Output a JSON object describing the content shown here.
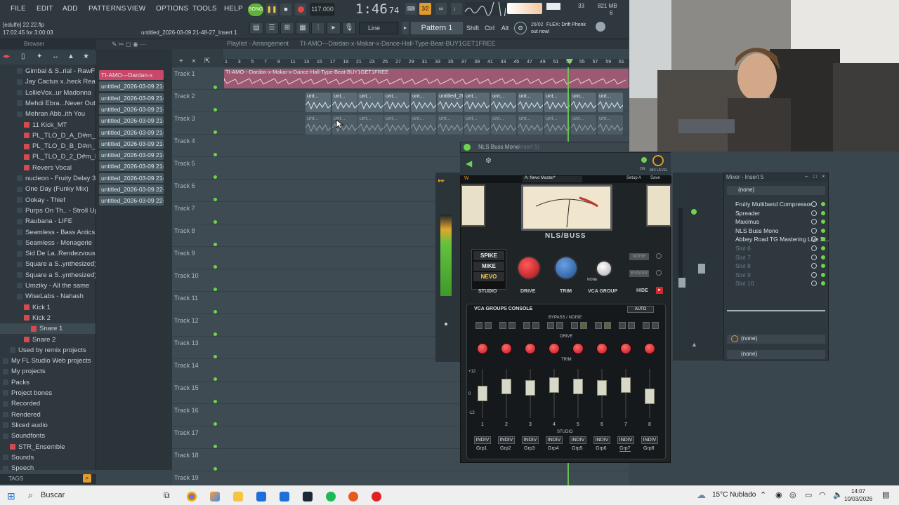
{
  "menu": {
    "items": [
      "FILE",
      "EDIT",
      "ADD",
      "PATTERNS",
      "VIEW",
      "OPTIONS",
      "TOOLS",
      "HELP"
    ],
    "song_label": "SONG",
    "tempo": "117.000",
    "time": "1:46",
    "time_sub": "74",
    "time_unit": "M:S:CS",
    "cpu": "33",
    "ram": "821 MB",
    "ram_sub": "6"
  },
  "hint_bar": {
    "file": "[edulfe] 22.22.flp",
    "elapsed": "17:02:45 for 3:00:03",
    "project_name": "untitled_2026-03-09 21-48-27_Insert 1"
  },
  "toolbar2": {
    "snap": "Line",
    "pattern": "Pattern 1",
    "keys": [
      "Shift",
      "Ctrl",
      "Alt"
    ],
    "news_date": "26/02",
    "news_text": "FLEX: Drift Phonk",
    "news_sub": "out now!"
  },
  "browser": {
    "title": "Browser",
    "items": [
      {
        "label": "Gimbal & S..rial - RawFL",
        "kind": "folder",
        "indent": 2
      },
      {
        "label": "Jay Cactus x..heck Ready",
        "kind": "folder",
        "indent": 2
      },
      {
        "label": "LollieVox..ur Madonna",
        "kind": "folder",
        "indent": 2
      },
      {
        "label": "Mehdi Ebra...Never Out",
        "kind": "folder",
        "indent": 2
      },
      {
        "label": "Mehran Abb..ith You",
        "kind": "folder-open",
        "indent": 2
      },
      {
        "label": "11 Kick_MT",
        "kind": "file",
        "indent": 3
      },
      {
        "label": "PL_TLO_D_A_D#m_Dry",
        "kind": "file",
        "indent": 3
      },
      {
        "label": "PL_TLO_D_B_D#m_Dry",
        "kind": "file",
        "indent": 3
      },
      {
        "label": "PL_TLO_D_2_D#m_Dry",
        "kind": "file",
        "indent": 3
      },
      {
        "label": "Revers Vocal",
        "kind": "file",
        "indent": 3
      },
      {
        "label": "nucleon - Fruity Delay 3",
        "kind": "folder",
        "indent": 2
      },
      {
        "label": "One Day (Funky Mix)",
        "kind": "folder",
        "indent": 2
      },
      {
        "label": "Ookay - Thief",
        "kind": "folder",
        "indent": 2
      },
      {
        "label": "Purps On Th.. - Stroll Up",
        "kind": "folder",
        "indent": 2
      },
      {
        "label": "Raubana - LIFE",
        "kind": "folder",
        "indent": 2
      },
      {
        "label": "Seamless - Bass Antics",
        "kind": "folder",
        "indent": 2
      },
      {
        "label": "Seamless - Menagerie",
        "kind": "folder",
        "indent": 2
      },
      {
        "label": "Sid De La..Rendezvous",
        "kind": "folder",
        "indent": 2
      },
      {
        "label": "Square a S..ynthesized)",
        "kind": "folder",
        "indent": 2
      },
      {
        "label": "Square a S..ynthesized)",
        "kind": "folder",
        "indent": 2
      },
      {
        "label": "Umziky - All the same",
        "kind": "folder",
        "indent": 2
      },
      {
        "label": "WiseLabs - Nahash",
        "kind": "folder-open",
        "indent": 2
      },
      {
        "label": "Kick 1",
        "kind": "file",
        "indent": 3
      },
      {
        "label": "Kick 2",
        "kind": "file",
        "indent": 3
      },
      {
        "label": "Snare 1",
        "kind": "file-sel",
        "indent": 4
      },
      {
        "label": "Snare 2",
        "kind": "file",
        "indent": 3
      },
      {
        "label": "Used by remix projects",
        "kind": "folder",
        "indent": 1
      },
      {
        "label": "My FL Studio Web projects",
        "kind": "folder",
        "indent": 0
      },
      {
        "label": "My projects",
        "kind": "folder",
        "indent": 0
      },
      {
        "label": "Packs",
        "kind": "folder",
        "indent": 0
      },
      {
        "label": "Project bones",
        "kind": "folder",
        "indent": 0
      },
      {
        "label": "Recorded",
        "kind": "plus",
        "indent": 0
      },
      {
        "label": "Rendered",
        "kind": "plus",
        "indent": 0
      },
      {
        "label": "Sliced audio",
        "kind": "plus",
        "indent": 0
      },
      {
        "label": "Soundfonts",
        "kind": "folder-open",
        "indent": 0
      },
      {
        "label": "STR_Ensemble",
        "kind": "file",
        "indent": 1
      },
      {
        "label": "Sounds",
        "kind": "folder",
        "indent": 0
      },
      {
        "label": "Speech",
        "kind": "folder",
        "indent": 0
      },
      {
        "label": "Templates",
        "kind": "folder",
        "indent": 0
      }
    ],
    "tags_label": "TAGS"
  },
  "playlist": {
    "title": "Playlist - Arrangement",
    "song_name": "TI-AMO---Dardan-x-Makar-x-Dance-Hall-Type-Beat-BUY1GET1FREE",
    "clips": [
      "TI-AMO---Dardan-x",
      "untitled_2026-03-09 21-",
      "untitled_2026-03-09 21-",
      "untitled_2026-03-09 21-",
      "untitled_2026-03-09 21-",
      "untitled_2026-03-09 21-",
      "untitled_2026-03-09 21-",
      "untitled_2026-03-09 21-",
      "untitled_2026-03-09 21-",
      "untitled_2026-03-09 21-",
      "untitled_2026-03-09 22-",
      "untitled_2026-03-09 22-"
    ],
    "tracks": [
      "Track 1",
      "Track 2",
      "Track 3",
      "Track 4",
      "Track 5",
      "Track 6",
      "Track 7",
      "Track 8",
      "Track 9",
      "Track 10",
      "Track 11",
      "Track 12",
      "Track 13",
      "Track 14",
      "Track 15",
      "Track 16",
      "Track 17",
      "Track 18",
      "Track 19"
    ],
    "ruler": [
      "1",
      "3",
      "5",
      "7",
      "9",
      "11",
      "13",
      "15",
      "17",
      "19",
      "21",
      "23",
      "25",
      "27",
      "29",
      "31",
      "33",
      "35",
      "37",
      "39",
      "41",
      "43",
      "45",
      "47",
      "49",
      "51",
      "53",
      "55",
      "57",
      "59",
      "61"
    ],
    "track2_clip_label": "untitled_2026-03-09 21-30-37_Insert 1",
    "unt_label": "unt..."
  },
  "plugin": {
    "window_title": "NLS Buss Mono",
    "window_title_sub": "(Insert 5)",
    "preset": "A: Nevo Master*",
    "setup": "Setup A",
    "save": "Save",
    "brand": "NLS/BUSS",
    "mix_level": "MIX LEVEL",
    "on": "ON",
    "models": [
      "SPIKE",
      "MIKE",
      "NEVO"
    ],
    "studio": "STUDIO",
    "drive": "DRIVE",
    "trim": "TRIM",
    "vca_group": "VCA GROUP",
    "noise": "NOISE",
    "bypass": "BYPASS",
    "hide": "HIDE",
    "none": "NONE",
    "console_title": "VCA GROUPS CONSOLE",
    "auto": "AUTO",
    "bypass_noise": "BYPASS / NOISE",
    "drive_row": "DRIVE",
    "trim_row": "TRIM",
    "studio_row": "STUDIO",
    "fader_numbers": [
      "1",
      "2",
      "3",
      "4",
      "5",
      "6",
      "7",
      "8"
    ],
    "indiv": "INDIV",
    "groups": [
      "Grp1",
      "Grp2",
      "Grp3",
      "Grp4",
      "Grp5",
      "Grp6",
      "Grp7",
      "Grp8"
    ],
    "scale_labels": [
      "+12",
      "0",
      "-12"
    ]
  },
  "mixer": {
    "title": "Mixer - Insert 5",
    "input": "(none)",
    "slots": [
      "Fruity Multiband Compressor",
      "Spreader",
      "Maximus",
      "NLS Buss Mono",
      "Abbey Road TG Mastering Live St..",
      "Slot 6",
      "Slot 7",
      "Slot 8",
      "Slot 9",
      "Slot 10"
    ],
    "output_top": "(none)",
    "output_bottom": "(none)"
  },
  "taskbar": {
    "search_placeholder": "Buscar",
    "weather": "15°C  Nublado",
    "time": "14:07",
    "date": "10/03/2026"
  }
}
